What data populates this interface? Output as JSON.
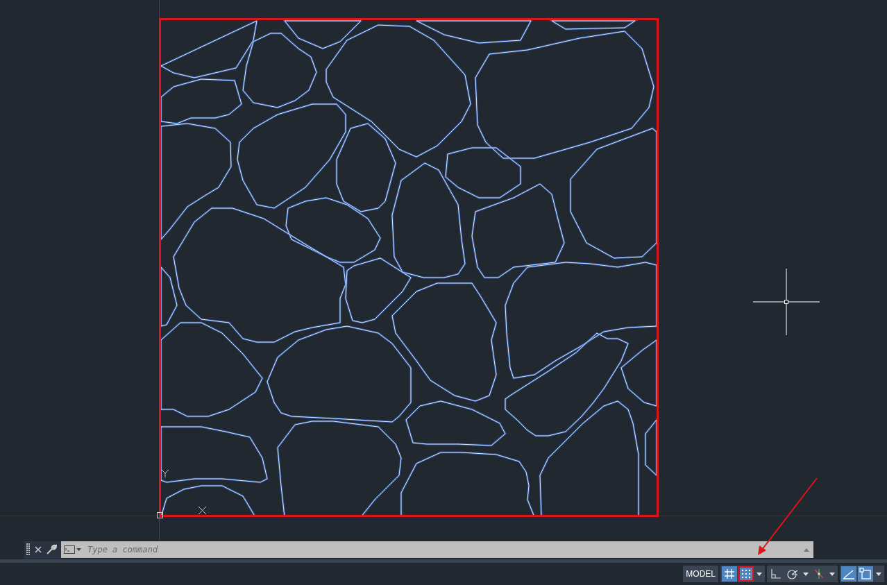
{
  "command_line": {
    "placeholder": "Type a command"
  },
  "status_bar": {
    "model_label": "MODEL",
    "toggles": [
      {
        "kind": "grid",
        "on": true,
        "selected": false,
        "dropdown": false
      },
      {
        "kind": "snap",
        "on": true,
        "selected": true,
        "dropdown": true
      },
      {
        "kind": "ortho",
        "on": false,
        "selected": false,
        "dropdown": false
      },
      {
        "kind": "polar",
        "on": false,
        "selected": false,
        "dropdown": true
      },
      {
        "kind": "track",
        "on": false,
        "selected": false,
        "dropdown": true
      },
      {
        "kind": "dynamic",
        "on": true,
        "selected": false,
        "dropdown": false
      },
      {
        "kind": "selection",
        "on": true,
        "selected": false,
        "dropdown": true
      }
    ]
  }
}
